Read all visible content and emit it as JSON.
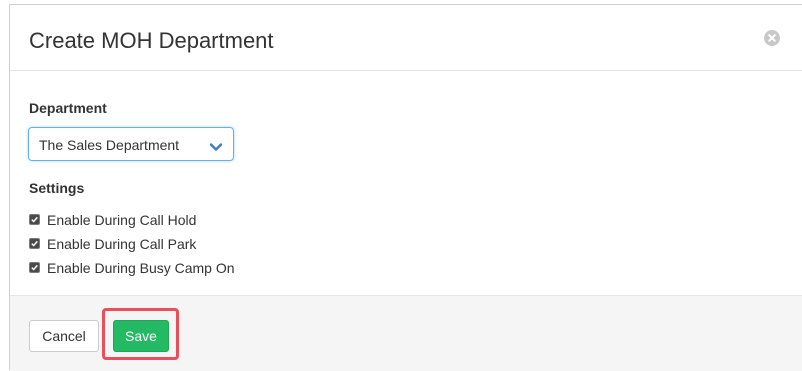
{
  "dialog": {
    "title": "Create MOH Department",
    "close_icon": "close-circle-icon"
  },
  "department": {
    "label": "Department",
    "selected": "The Sales Department",
    "dropdown_icon": "chevron-down-icon"
  },
  "settings": {
    "label": "Settings",
    "options": [
      {
        "label": "Enable During Call Hold",
        "checked": true
      },
      {
        "label": "Enable During Call Park",
        "checked": true
      },
      {
        "label": "Enable During Busy Camp On",
        "checked": true
      }
    ]
  },
  "footer": {
    "cancel_label": "Cancel",
    "save_label": "Save",
    "save_color": "#24b963",
    "highlight_color": "#e8505b"
  }
}
